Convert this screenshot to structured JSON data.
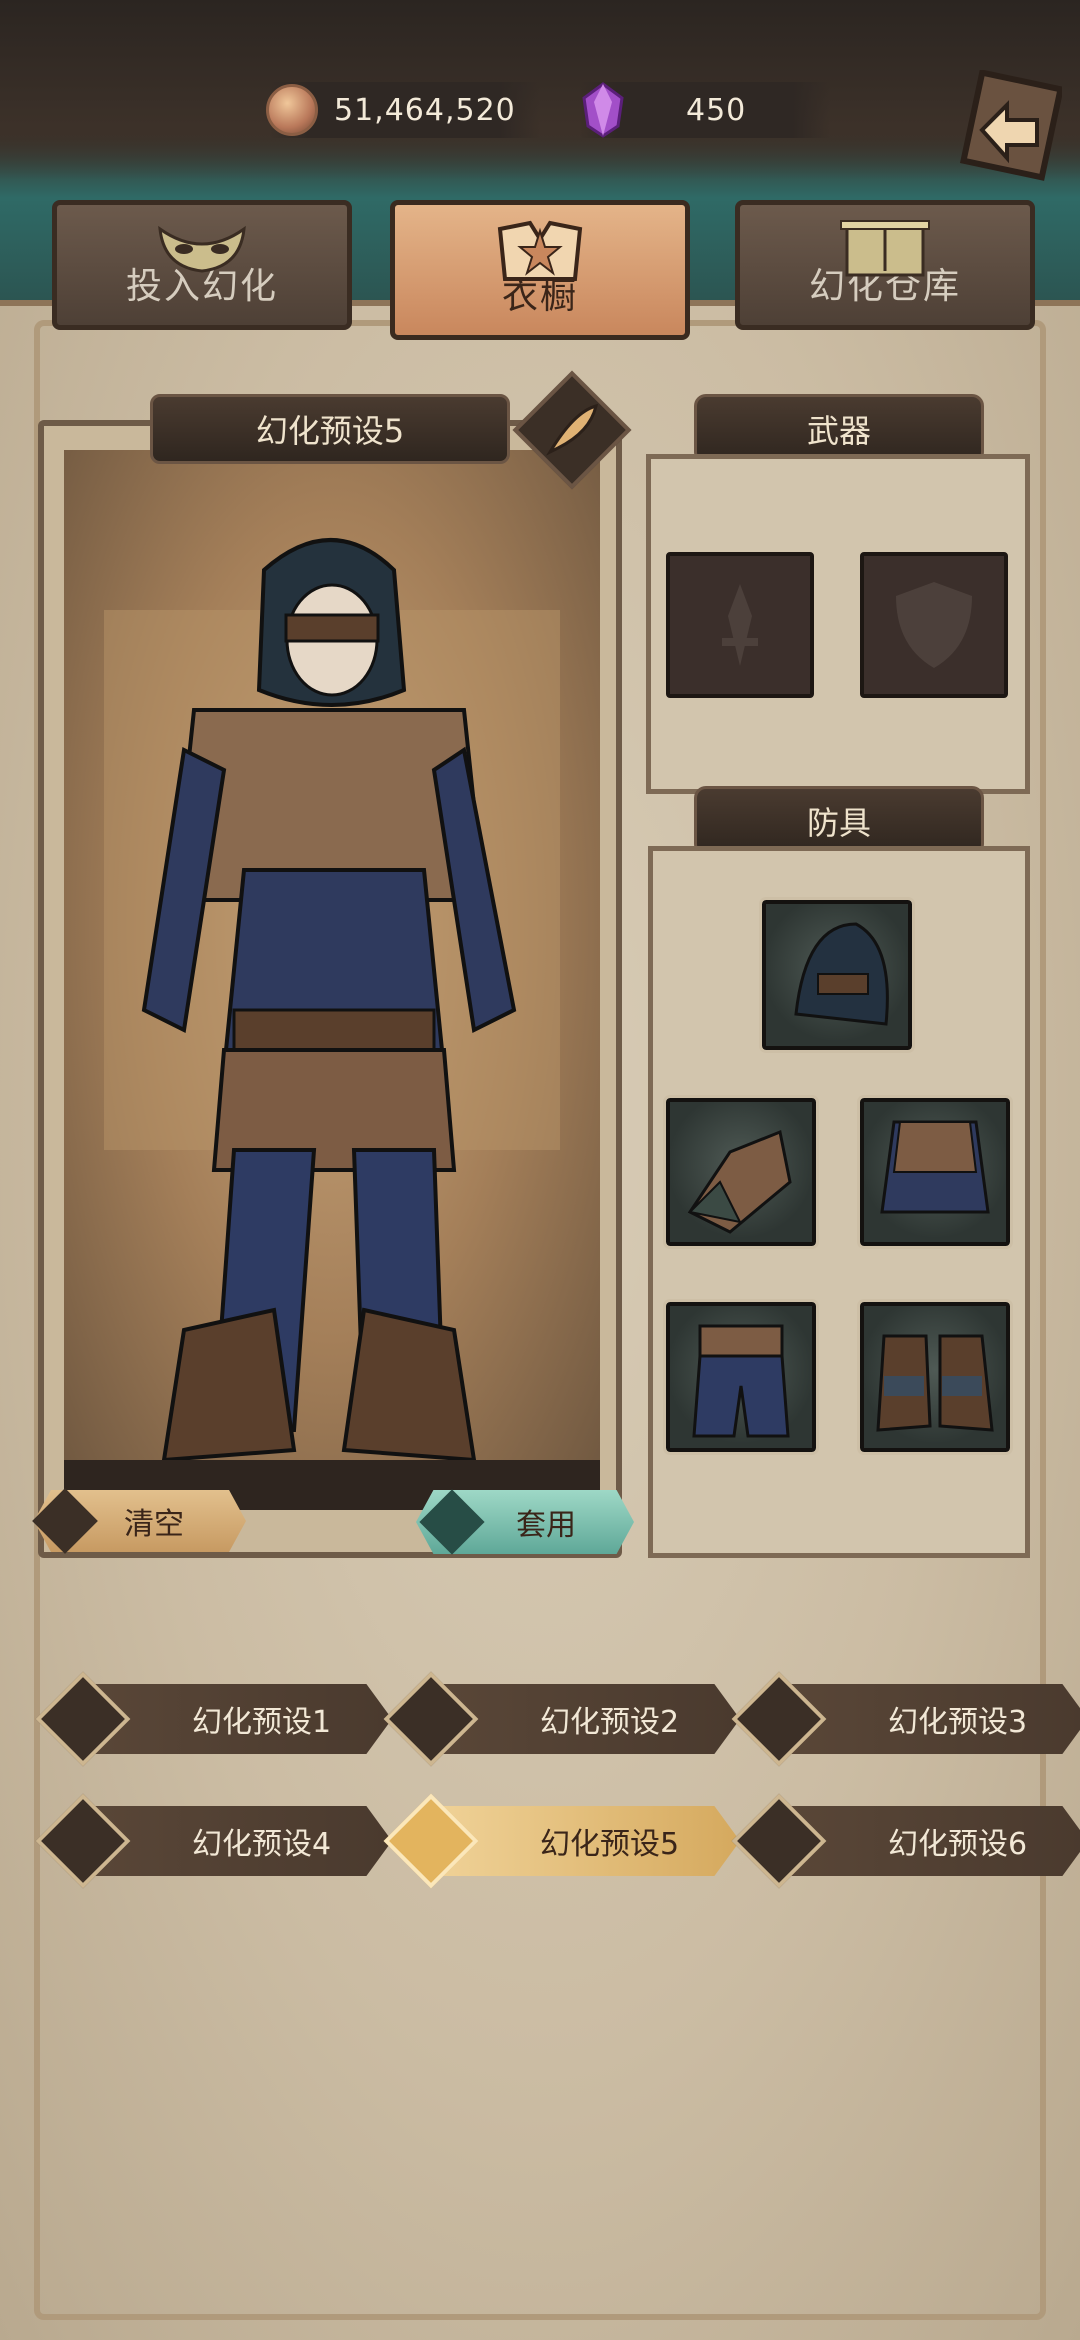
{
  "currency": {
    "gold": "51,464,520",
    "gems": "450"
  },
  "tabs": [
    {
      "label": "投入幻化",
      "active": false
    },
    {
      "label": "衣橱",
      "active": true
    },
    {
      "label": "幻化仓库",
      "active": false
    }
  ],
  "preset_panel": {
    "title": "幻化预设5",
    "clear_label": "清空",
    "apply_label": "套用"
  },
  "weapon_section": {
    "title": "武器",
    "slots": [
      "main-hand",
      "off-hand"
    ]
  },
  "armor_section": {
    "title": "防具",
    "slots": [
      "hood",
      "bracers",
      "chest",
      "pants",
      "boots"
    ]
  },
  "presets": [
    {
      "label": "幻化预设1",
      "selected": false
    },
    {
      "label": "幻化预设2",
      "selected": false
    },
    {
      "label": "幻化预设3",
      "selected": false
    },
    {
      "label": "幻化预设4",
      "selected": false
    },
    {
      "label": "幻化预设5",
      "selected": true
    },
    {
      "label": "幻化预设6",
      "selected": false
    }
  ],
  "colors": {
    "accent_gold": "#d5a95e",
    "apply_teal": "#5fa898",
    "dark_panel": "#2f261f"
  }
}
